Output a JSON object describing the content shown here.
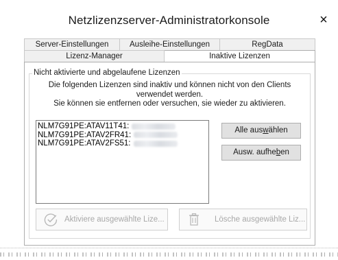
{
  "window": {
    "title": "Netzlizenzserver-Administratorkonsole",
    "close_glyph": "×"
  },
  "tabs": {
    "row1": [
      {
        "label": "Server-Einstellungen"
      },
      {
        "label": "Ausleihe-Einstellungen"
      },
      {
        "label": "RegData"
      }
    ],
    "row2": [
      {
        "label": "Lizenz-Manager"
      },
      {
        "label": "Inaktive Lizenzen",
        "active": true
      }
    ]
  },
  "group": {
    "legend": "Nicht aktivierte und abgelaufene Lizenzen",
    "desc_line1": "Die folgenden Lizenzen sind inaktiv und können nicht von den Clients",
    "desc_line2": "verwendet werden.",
    "desc_line3": "Sie können sie entfernen oder versuchen, sie wieder zu aktivieren."
  },
  "licenses": [
    {
      "id": "NLM7G91PE:ATAV11T41:"
    },
    {
      "id": "NLM7G91PE:ATAV2FR41:"
    },
    {
      "id": "NLM7G91PE:ATAV2FS51:"
    }
  ],
  "buttons": {
    "select_all_pre": "Alle aus",
    "select_all_ul": "w",
    "select_all_post": "ählen",
    "deselect_pre": "Ausw. aufhe",
    "deselect_ul": "b",
    "deselect_post": "en",
    "activate_label": "Aktiviere ausgewählte Lize...",
    "delete_label": "Lösche ausgewählte Liz..."
  },
  "icons": {
    "activate": "checkmark-circle-icon",
    "delete": "trash-icon",
    "close": "close-icon"
  },
  "colors": {
    "disabled_text": "#a8a8a8",
    "button_face": "#e1e1e1"
  }
}
